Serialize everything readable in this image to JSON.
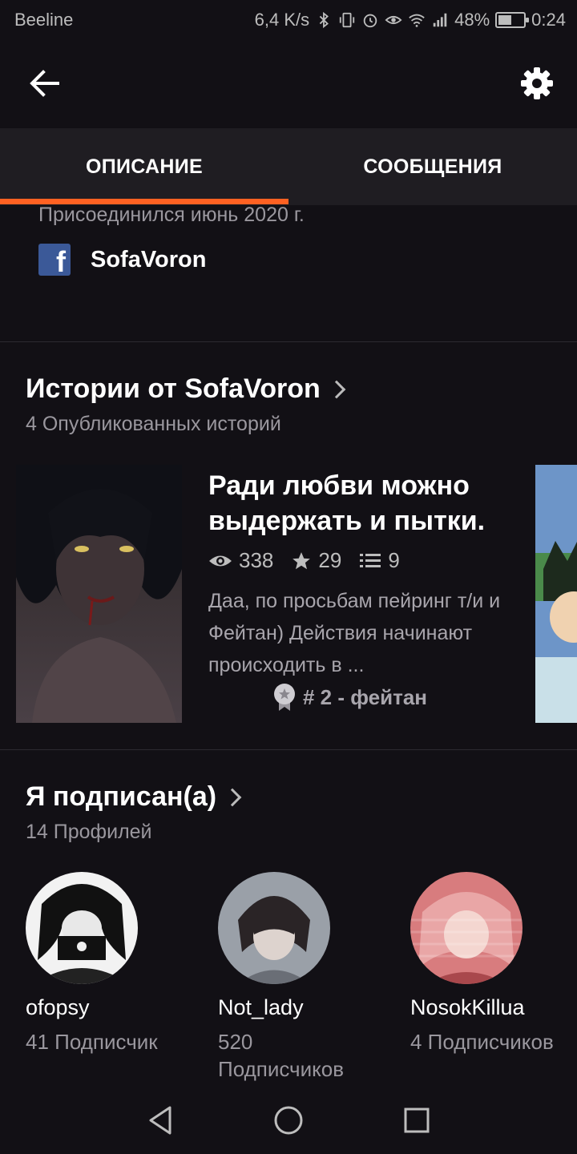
{
  "status": {
    "carrier": "Beeline",
    "speed": "6,4 K/s",
    "battery": "48%",
    "time": "0:24"
  },
  "tabs": [
    {
      "label": "ОПИСАНИЕ",
      "active": true
    },
    {
      "label": "СООБЩЕНИЯ",
      "active": false
    }
  ],
  "profile": {
    "joined": "Присоединился июнь 2020 г.",
    "facebook": "SofaVoron"
  },
  "stories": {
    "title": "Истории от SofaVoron",
    "subtitle": "4 Опубликованных историй",
    "items": [
      {
        "title": "Ради любви можно выдержать и пытки.",
        "views": "338",
        "votes": "29",
        "parts": "9",
        "description": "Даа, по просьбам пейринг т/и и Фейтан) Действия начинают происходить в ...",
        "rank": "# 2 - фейтан"
      }
    ]
  },
  "following": {
    "title": "Я подписан(а)",
    "subtitle": "14 Профилей",
    "items": [
      {
        "name": "ofopsy",
        "followers": "41 Подписчик"
      },
      {
        "name": "Not_lady",
        "followers": "520 Подписчиков"
      },
      {
        "name": "NosokKillua",
        "followers": "4 Подписчиков"
      }
    ]
  },
  "colors": {
    "accent": "#ff6122",
    "background": "#121015",
    "tab_bg": "#1f1d22",
    "facebook": "#3b5998"
  }
}
